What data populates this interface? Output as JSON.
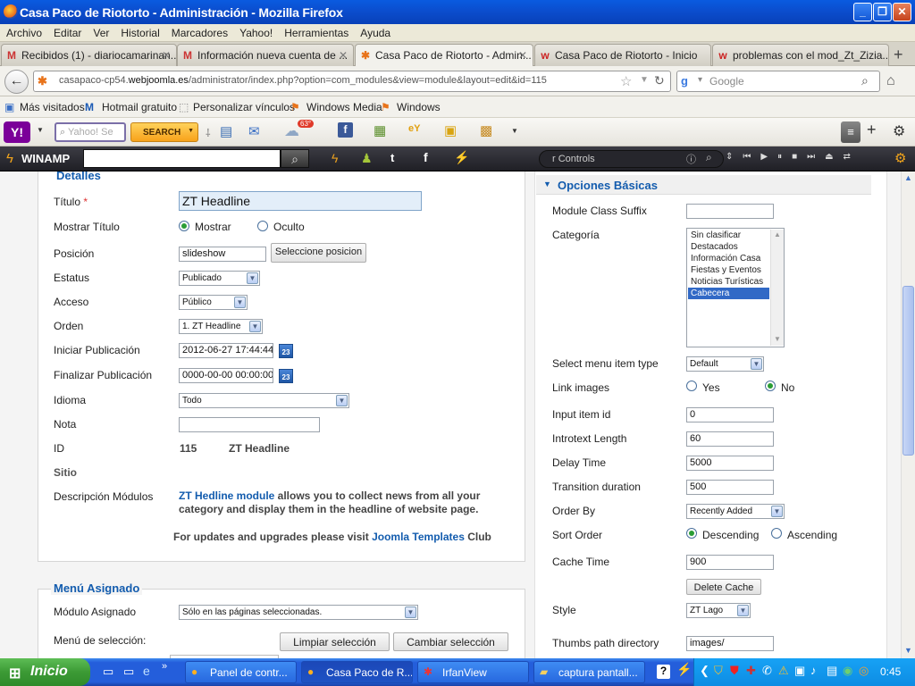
{
  "window": {
    "title": "Casa Paco de Riotorto - Administración - Mozilla Firefox"
  },
  "menu": [
    "Archivo",
    "Editar",
    "Ver",
    "Historial",
    "Marcadores",
    "Yahoo!",
    "Herramientas",
    "Ayuda"
  ],
  "tabs": [
    {
      "label": "Recibidos (1) - diariocamarinan...",
      "icon": "gmail-icon"
    },
    {
      "label": "Información nueva cuenta de ...",
      "icon": "gmail-icon"
    },
    {
      "label": "Casa Paco de Riotorto - Admin...",
      "icon": "joomla-icon",
      "active": true
    },
    {
      "label": "Casa Paco de Riotorto - Inicio",
      "icon": "webjoomla-icon"
    },
    {
      "label": "problemas con el mod_Zt_Zizia...",
      "icon": "webjoomla-icon"
    }
  ],
  "nav": {
    "url_prefix": "casapaco-cp54.",
    "url_domain": "webjoomla.es",
    "url_rest": "/administrator/index.php?option=com_modules&view=module&layout=edit&id=115",
    "search_placeholder": "Google"
  },
  "bookmarks": [
    "Más visitados",
    "Hotmail gratuito",
    "Personalizar vínculos",
    "Windows Media",
    "Windows"
  ],
  "yahoo": {
    "search_placeholder": "Yahoo! Se",
    "search_button": "SEARCH",
    "weather": "63°"
  },
  "winamp": {
    "logo": "WINAMP",
    "controls_label": "r Controls"
  },
  "details": {
    "legend": "Detalles",
    "titulo_label": "Título",
    "required": "*",
    "titulo_value": "ZT Headline",
    "mostrar_label": "Mostrar Título",
    "mostrar_opt1": "Mostrar",
    "mostrar_opt2": "Oculto",
    "posicion_label": "Posición",
    "posicion_value": "slideshow",
    "posicion_button": "Seleccione posicion",
    "estatus_label": "Estatus",
    "estatus_value": "Publicado",
    "acceso_label": "Acceso",
    "acceso_value": "Público",
    "orden_label": "Orden",
    "orden_value": "1. ZT Headline",
    "iniciar_label": "Iniciar Publicación",
    "iniciar_value": "2012-06-27 17:44:44",
    "finalizar_label": "Finalizar Publicación",
    "finalizar_value": "0000-00-00 00:00:00",
    "idioma_label": "Idioma",
    "idioma_value": "Todo",
    "nota_label": "Nota",
    "nota_value": "",
    "id_label": "ID",
    "id_value": "115",
    "id_name": "ZT Headline",
    "sitio_label": "Sitio",
    "desc_label": "Descripción Módulos",
    "desc_link": "ZT Hedline module",
    "desc_text1": " allows you to collect news from all your",
    "desc_text2": "category and display them in the headline of website page.",
    "updates_text": "For updates and upgrades please visit ",
    "updates_link": "Joomla Templates",
    "updates_tail": " Club"
  },
  "assigned": {
    "legend": "Menú Asignado",
    "modulo_label": "Módulo Asignado",
    "modulo_value": "Sólo en las páginas seleccionadas.",
    "seleccion_label": "Menú de selección:",
    "clear_button": "Limpiar selección",
    "change_button": "Cambiar selección"
  },
  "options": {
    "header": "Opciones Básicas",
    "suffix_label": "Module Class Suffix",
    "suffix_value": "",
    "categoria_label": "Categoría",
    "categories": [
      "Sin clasificar",
      "Destacados",
      "Información Casa",
      "Fiestas y Eventos",
      "Noticias Turísticas",
      "Cabecera"
    ],
    "selected_category": "Cabecera",
    "menuitem_label": "Select menu item type",
    "menuitem_value": "Default",
    "linkimages_label": "Link images",
    "yes": "Yes",
    "no": "No",
    "inputid_label": "Input item id",
    "inputid_value": "0",
    "introtext_label": "Introtext Length",
    "introtext_value": "60",
    "delay_label": "Delay Time",
    "delay_value": "5000",
    "transition_label": "Transition duration",
    "transition_value": "500",
    "orderby_label": "Order By",
    "orderby_value": "Recently Added",
    "sortorder_label": "Sort Order",
    "descending": "Descending",
    "ascending": "Ascending",
    "cache_label": "Cache Time",
    "cache_value": "900",
    "delete_cache": "Delete Cache",
    "style_label": "Style",
    "style_value": "ZT Lago",
    "thumbs_label": "Thumbs path directory",
    "thumbs_value": "images/"
  },
  "taskbar": {
    "start": "Inicio",
    "items": [
      "Panel de contr...",
      "Casa Paco de R...",
      "IrfanView",
      "captura pantall..."
    ],
    "clock": "0:45"
  }
}
